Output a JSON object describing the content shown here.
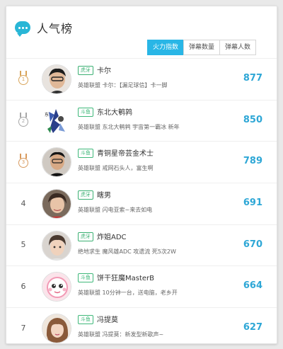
{
  "header": {
    "title": "人气榜",
    "logo_icon": "chat-bubble-icon"
  },
  "tabs": [
    {
      "label": "火力指数",
      "active": true
    },
    {
      "label": "弹幕数量",
      "active": false
    },
    {
      "label": "弹幕人数",
      "active": false
    }
  ],
  "colors": {
    "accent": "#29b6e6",
    "score": "#2ea7d6",
    "badge": "#3bb073"
  },
  "rows": [
    {
      "rank": "1",
      "rank_type": "medal-gold",
      "platform": "虎牙",
      "name": "卡尔",
      "desc": "英雄联盟 卡尔：【漏足球信】卡一脚",
      "score": "877"
    },
    {
      "rank": "2",
      "rank_type": "medal-silver",
      "platform": "斗鱼",
      "name": "东北大鹌鹑",
      "desc": "英雄联盟 东北大鹌鹑 宇宙第一霸冰 新年",
      "score": "850"
    },
    {
      "rank": "3",
      "rank_type": "medal-bronze",
      "platform": "斗鱼",
      "name": "青铜星帝芸金术士",
      "desc": "英雄联盟 戒网石头人，富生啊",
      "score": "789"
    },
    {
      "rank": "4",
      "rank_type": "number",
      "platform": "虎牙",
      "name": "瞎男",
      "desc": "英雄联盟 闪电亚索~来去如电",
      "score": "691"
    },
    {
      "rank": "5",
      "rank_type": "number",
      "platform": "虎牙",
      "name": "炸姐ADC",
      "desc": "绝地求生 魔风雄ADC 攻遗流 死5次2W",
      "score": "670"
    },
    {
      "rank": "6",
      "rank_type": "number",
      "platform": "斗鱼",
      "name": "饼干狂魔MasterB",
      "desc": "英雄联盟 10分钟一台，送电脑，老乡开",
      "score": "664"
    },
    {
      "rank": "7",
      "rank_type": "number",
      "platform": "斗鱼",
      "name": "冯提莫",
      "desc": "英雄联盟 冯提莫：新发型新歌声~",
      "score": "627"
    }
  ]
}
